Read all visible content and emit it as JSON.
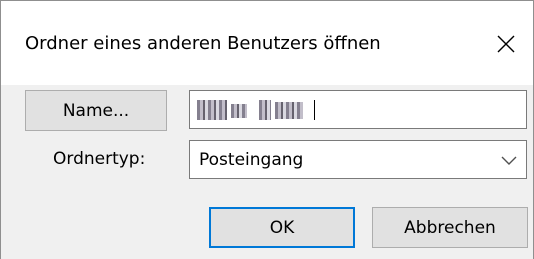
{
  "dialog": {
    "title": "Ordner eines anderen Benutzers öffnen",
    "close_icon": "close-icon"
  },
  "name_button": {
    "label": "Name..."
  },
  "name_field": {
    "value_redacted": true
  },
  "folder_type": {
    "label": "Ordnertyp:",
    "selected": "Posteingang",
    "dropdown_icon": "chevron-down-icon"
  },
  "buttons": {
    "ok": "OK",
    "cancel": "Abbrechen"
  },
  "colors": {
    "background": "#f0f0f0",
    "button_bg": "#e1e1e1",
    "focus_border": "#0078d7"
  }
}
